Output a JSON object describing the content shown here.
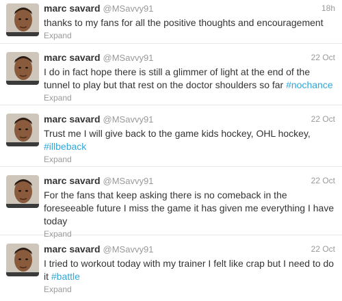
{
  "tweets": [
    {
      "name": "marc savard",
      "handle": "@MSavvy91",
      "time": "18h",
      "text": "thanks to my fans for all the positive thoughts and encouragement",
      "hashtag": "",
      "expand": "Expand"
    },
    {
      "name": "marc savard",
      "handle": "@MSavvy91",
      "time": "22 Oct",
      "text": "I do in fact hope there is still a glimmer of light at the end of the tunnel to play but that rest on the doctor shoulders so far ",
      "hashtag": "#nochance",
      "expand": "Expand"
    },
    {
      "name": "marc savard",
      "handle": "@MSavvy91",
      "time": "22 Oct",
      "text": "Trust me I will give back to the game kids hockey, OHL hockey, ",
      "hashtag": "#illbeback",
      "expand": "Expand"
    },
    {
      "name": "marc savard",
      "handle": "@MSavvy91",
      "time": "22 Oct",
      "text": "For the fans that keep asking there is no comeback in the foreseeable future I miss the game it has given me everything I have today",
      "hashtag": "",
      "expand": "Expand"
    },
    {
      "name": "marc savard",
      "handle": "@MSavvy91",
      "time": "22 Oct",
      "text": "I tried to workout today with my trainer I felt like crap but I need to do it ",
      "hashtag": "#battle",
      "expand": "Expand"
    }
  ]
}
